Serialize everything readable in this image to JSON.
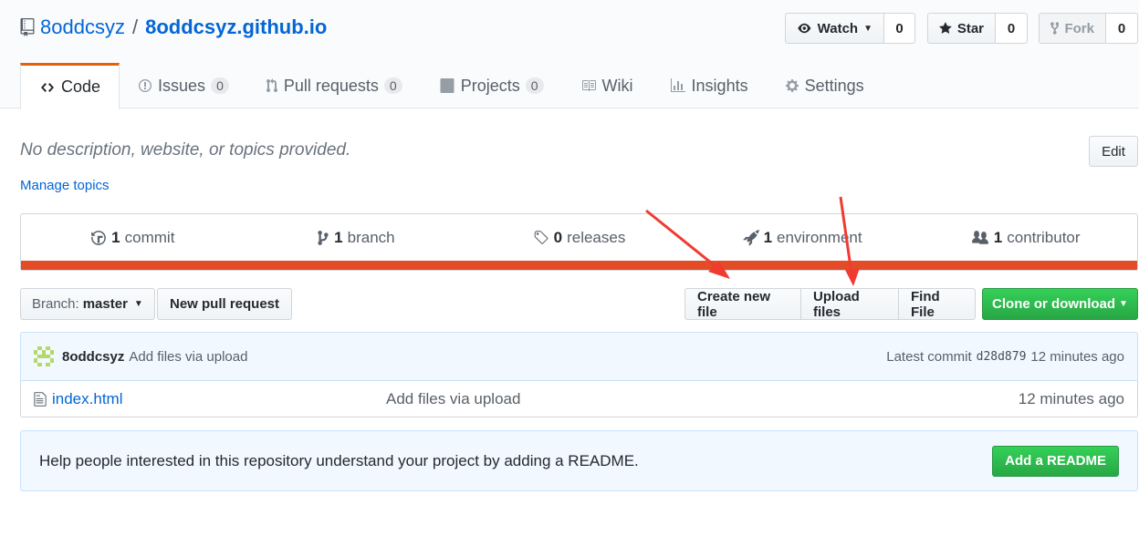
{
  "repo": {
    "owner": "8oddcsyz",
    "separator": "/",
    "name": "8oddcsyz.github.io"
  },
  "actions": {
    "watch_label": "Watch",
    "watch_count": "0",
    "star_label": "Star",
    "star_count": "0",
    "fork_label": "Fork",
    "fork_count": "0"
  },
  "tabs": [
    {
      "label": "Code",
      "icon": "code-icon"
    },
    {
      "label": "Issues",
      "count": "0",
      "icon": "issue-icon"
    },
    {
      "label": "Pull requests",
      "count": "0",
      "icon": "pull-request-icon"
    },
    {
      "label": "Projects",
      "count": "0",
      "icon": "project-icon"
    },
    {
      "label": "Wiki",
      "icon": "book-icon"
    },
    {
      "label": "Insights",
      "icon": "graph-icon"
    },
    {
      "label": "Settings",
      "icon": "gear-icon"
    }
  ],
  "about": {
    "description": "No description, website, or topics provided.",
    "manage_topics": "Manage topics",
    "edit_label": "Edit"
  },
  "summary": [
    {
      "count": "1",
      "label": "commit",
      "icon": "history-icon"
    },
    {
      "count": "1",
      "label": "branch",
      "icon": "branch-icon"
    },
    {
      "count": "0",
      "label": "releases",
      "icon": "tag-icon"
    },
    {
      "count": "1",
      "label": "environment",
      "icon": "rocket-icon"
    },
    {
      "count": "1",
      "label": "contributor",
      "icon": "people-icon"
    }
  ],
  "toolbar": {
    "branch_prefix": "Branch:",
    "branch_name": "master",
    "new_pr": "New pull request",
    "create_file": "Create new file",
    "upload_files": "Upload files",
    "find_file": "Find File",
    "clone": "Clone or download"
  },
  "commit": {
    "author": "8oddcsyz",
    "message": "Add files via upload",
    "latest_label": "Latest commit",
    "sha": "d28d879",
    "age": "12 minutes ago"
  },
  "files": [
    {
      "name": "index.html",
      "message": "Add files via upload",
      "age": "12 minutes ago"
    }
  ],
  "readme_prompt": {
    "text": "Help people interested in this repository understand your project by adding a README.",
    "button": "Add a README"
  },
  "colors": {
    "language_bar": "#e34c26",
    "annotation_arrow": "#f03c30",
    "accent_green": "#28a745",
    "link": "#0366d6"
  }
}
